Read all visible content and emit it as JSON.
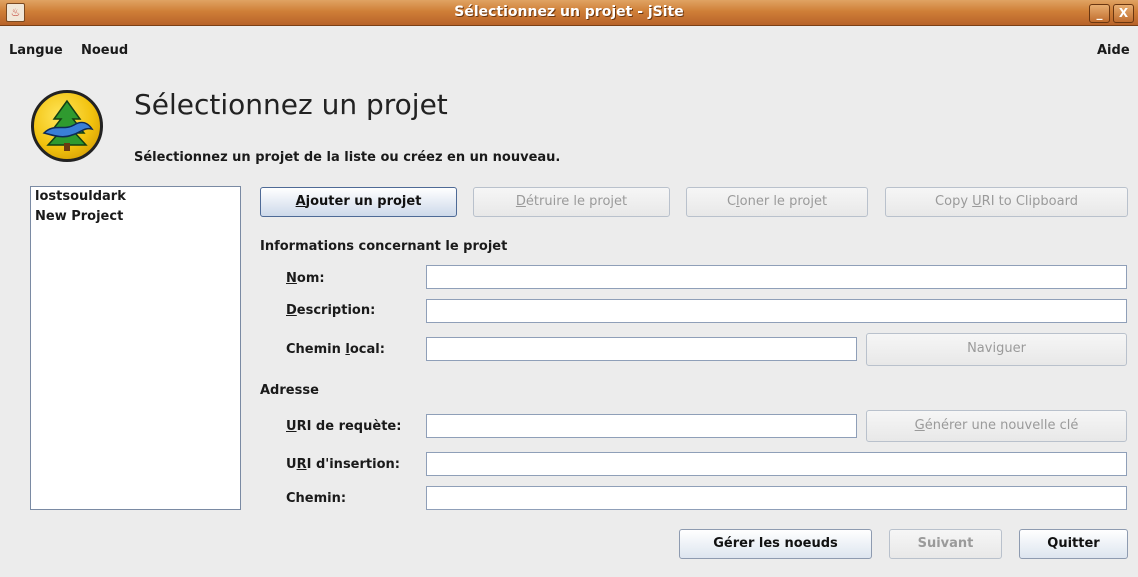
{
  "window": {
    "title": "Sélectionnez un projet - jSite",
    "minimize_glyph": "_",
    "close_glyph": "X"
  },
  "menubar": {
    "langue": "Langue",
    "noeud": "Noeud",
    "aide": "Aide"
  },
  "header": {
    "title": "Sélectionnez un projet",
    "subtitle": "Sélectionnez un projet de la liste ou créez en un nouveau."
  },
  "projects": {
    "items": [
      {
        "label": "lostsouldark"
      },
      {
        "label": "New Project"
      }
    ]
  },
  "actions": {
    "add": {
      "mnemonic": "A",
      "rest": "jouter un projet"
    },
    "delete": {
      "mnemonic": "D",
      "rest": "étruire le projet"
    },
    "clone": {
      "pre": "C",
      "mnemonic": "l",
      "rest": "oner le projet"
    },
    "copy_uri": {
      "pre": "Copy ",
      "mnemonic": "U",
      "rest": "RI to Clipboard"
    }
  },
  "project_info": {
    "section_label": "Informations concernant le projet",
    "name": {
      "mnemonic": "N",
      "rest": "om:",
      "value": ""
    },
    "description": {
      "mnemonic": "D",
      "rest": "escription:",
      "value": ""
    },
    "local_path": {
      "pre": "Chemin ",
      "mnemonic": "l",
      "rest": "ocal:",
      "value": ""
    },
    "browse_label": "Naviguer"
  },
  "address": {
    "section_label": "Adresse",
    "request_uri": {
      "mnemonic": "U",
      "rest": "RI de requète:",
      "value": ""
    },
    "generate_key": {
      "mnemonic": "G",
      "rest": "énérer une nouvelle clé"
    },
    "insert_uri": {
      "pre": "U",
      "mnemonic": "R",
      "rest": "I d'insertion:",
      "value": ""
    },
    "path": {
      "label": "Chemin:",
      "value": ""
    }
  },
  "footer": {
    "manage_nodes": "Gérer les noeuds",
    "next": "Suivant",
    "quit": "Quitter"
  }
}
